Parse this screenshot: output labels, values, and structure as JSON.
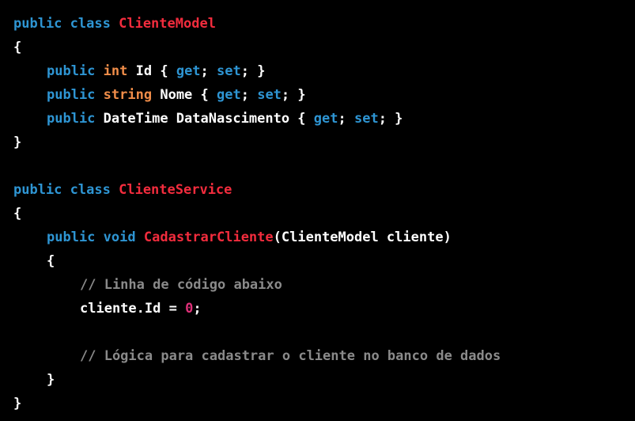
{
  "code": {
    "lines": [
      {
        "tokens": [
          "public",
          " ",
          "class",
          " ",
          "ClienteModel"
        ]
      },
      {
        "tokens": [
          "{"
        ]
      },
      {
        "tokens": [
          "public",
          " ",
          "int",
          " ",
          "Id { ",
          "get",
          "; ",
          "set",
          "; }"
        ]
      },
      {
        "tokens": [
          "public",
          " ",
          "string",
          " ",
          "Nome { ",
          "get",
          "; ",
          "set",
          "; }"
        ]
      },
      {
        "tokens": [
          "public",
          " ",
          "DateTime DataNascimento { ",
          "get",
          "; ",
          "set",
          "; }"
        ]
      },
      {
        "tokens": [
          "}"
        ]
      },
      {
        "tokens": [
          ""
        ]
      },
      {
        "tokens": [
          "public",
          " ",
          "class",
          " ",
          "ClienteService"
        ]
      },
      {
        "tokens": [
          "{"
        ]
      },
      {
        "tokens": [
          "public",
          " ",
          "void",
          " ",
          "CadastrarCliente",
          "(ClienteModel cliente)"
        ]
      },
      {
        "tokens": [
          "{"
        ]
      },
      {
        "tokens": [
          "// Linha de código abaixo"
        ]
      },
      {
        "tokens": [
          "cliente.Id = ",
          "0",
          ";"
        ]
      },
      {
        "tokens": [
          ""
        ]
      },
      {
        "tokens": [
          "// Lógica para cadastrar o cliente no banco de dados"
        ]
      },
      {
        "tokens": [
          "}"
        ]
      },
      {
        "tokens": [
          "}"
        ]
      }
    ]
  },
  "colors": {
    "background": "#000000",
    "keyword": "#2e95d3",
    "type_highlight": "#f08d49",
    "class_name": "#f22c3d",
    "number": "#df3079",
    "comment": "#8a8a8a",
    "plain": "#ffffff"
  }
}
